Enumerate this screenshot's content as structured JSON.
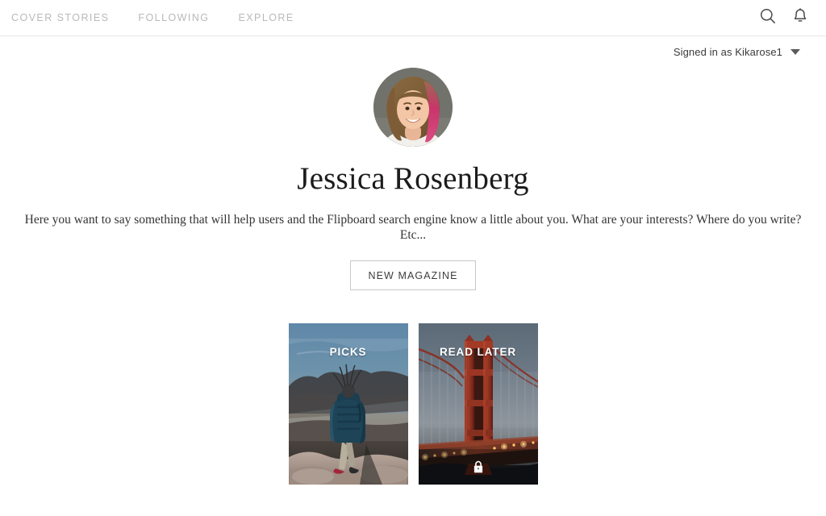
{
  "header": {
    "nav": [
      {
        "label": "COVER STORIES",
        "name": "nav-cover-stories"
      },
      {
        "label": "FOLLOWING",
        "name": "nav-following"
      },
      {
        "label": "EXPLORE",
        "name": "nav-explore"
      }
    ],
    "icons": {
      "search": "search-icon",
      "notifications": "bell-icon"
    }
  },
  "account": {
    "signed_in_text": "Signed in as Kikarose1",
    "dropdown_icon": "chevron-down-icon"
  },
  "profile": {
    "avatar_alt": "avatar",
    "name": "Jessica Rosenberg",
    "bio": "Here you want to say something that will help users and the Flipboard search engine know a little about you. What are your interests? Where do you write? Etc...",
    "new_magazine_label": "NEW MAGAZINE"
  },
  "magazines": [
    {
      "title": "PICKS",
      "private": false,
      "cover_alt": "hiker-on-cliff-at-dusk"
    },
    {
      "title": "READ LATER",
      "private": true,
      "lock_icon": "lock-icon",
      "cover_alt": "golden-gate-bridge-at-dusk"
    }
  ],
  "colors": {
    "nav_text": "#b9b9bd",
    "border": "#e6e6e6",
    "body_text": "#333333",
    "background": "#ffffff"
  }
}
